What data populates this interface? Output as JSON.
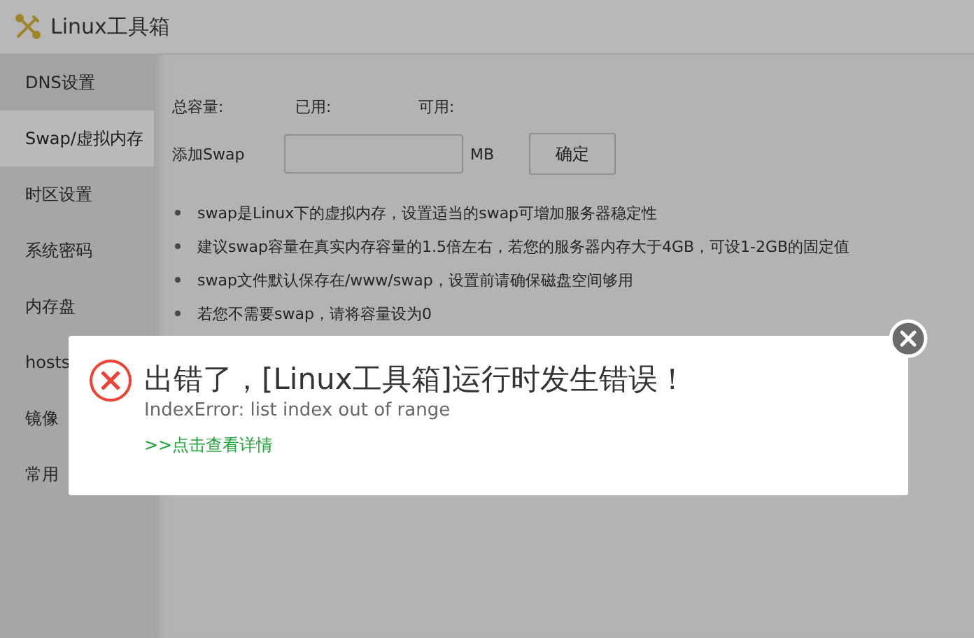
{
  "window": {
    "title": "Linux工具箱"
  },
  "sidebar": {
    "items": [
      {
        "label": "DNS设置",
        "selected": false
      },
      {
        "label": "Swap/虚拟内存",
        "selected": true
      },
      {
        "label": "时区设置",
        "selected": false
      },
      {
        "label": "系统密码",
        "selected": false
      },
      {
        "label": "内存盘",
        "selected": false
      },
      {
        "label": "hosts",
        "selected": false
      },
      {
        "label": "镜像",
        "selected": false
      },
      {
        "label": "常用",
        "selected": false
      }
    ]
  },
  "stats": [
    {
      "label": "总容量:"
    },
    {
      "label": "已用:"
    },
    {
      "label": "可用:"
    }
  ],
  "swap_form": {
    "label": "添加Swap",
    "unit": "MB",
    "button": "确定"
  },
  "notes": [
    "swap是Linux下的虚拟内存，设置适当的swap可增加服务器稳定性",
    "建议swap容量在真实内存容量的1.5倍左右，若您的服务器内存大于4GB，可设1-2GB的固定值",
    "swap文件默认保存在/www/swap，设置前请确保磁盘空间够用",
    "若您不需要swap，请将容量设为0"
  ],
  "error_dialog": {
    "title": "出错了，[Linux工具箱]运行时发生错误！",
    "message": "IndexError: list index out of range",
    "link": ">>点击查看详情"
  }
}
